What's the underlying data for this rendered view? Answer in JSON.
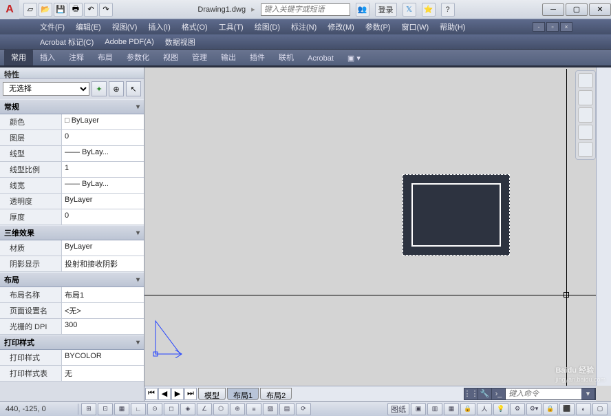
{
  "title": "Drawing1.dwg",
  "search_placeholder": "键入关键字或短语",
  "login_label": "登录",
  "menus1": [
    "文件(F)",
    "编辑(E)",
    "视图(V)",
    "插入(I)",
    "格式(O)",
    "工具(T)",
    "绘图(D)",
    "标注(N)",
    "修改(M)",
    "参数(P)",
    "窗口(W)",
    "帮助(H)"
  ],
  "menus2": [
    "Acrobat 标记(C)",
    "Adobe PDF(A)",
    "数据视图"
  ],
  "ribbon_tabs": [
    "常用",
    "插入",
    "注释",
    "布局",
    "参数化",
    "视图",
    "管理",
    "输出",
    "插件",
    "联机",
    "Acrobat"
  ],
  "ribbon_extra": "▣ ▾",
  "palette": {
    "title": "特性",
    "selection": "无选择",
    "cats": [
      {
        "name": "常规",
        "rows": [
          {
            "k": "颜色",
            "v": "□ ByLayer"
          },
          {
            "k": "图层",
            "v": "0"
          },
          {
            "k": "线型",
            "v": "—— ByLay..."
          },
          {
            "k": "线型比例",
            "v": "1"
          },
          {
            "k": "线宽",
            "v": "—— ByLay..."
          },
          {
            "k": "透明度",
            "v": "ByLayer"
          },
          {
            "k": "厚度",
            "v": "0"
          }
        ]
      },
      {
        "name": "三维效果",
        "rows": [
          {
            "k": "材质",
            "v": "ByLayer"
          },
          {
            "k": "阴影显示",
            "v": "投射和接收阴影"
          }
        ]
      },
      {
        "name": "布局",
        "rows": [
          {
            "k": "布局名称",
            "v": "布局1"
          },
          {
            "k": "页面设置名",
            "v": "<无>"
          },
          {
            "k": "光栅的 DPI",
            "v": "300"
          }
        ]
      },
      {
        "name": "打印样式",
        "rows": [
          {
            "k": "打印样式",
            "v": "BYCOLOR"
          },
          {
            "k": "打印样式表",
            "v": "无"
          }
        ]
      }
    ]
  },
  "layout_tabs": {
    "model": "模型",
    "l1": "布局1",
    "l2": "布局2"
  },
  "cmd_placeholder": "键入命令",
  "coords": "440, -125,  0",
  "paperspace_label": "图纸",
  "watermark": {
    "brand": "Baidu 经验",
    "url": "jingyan.baidu.com"
  }
}
